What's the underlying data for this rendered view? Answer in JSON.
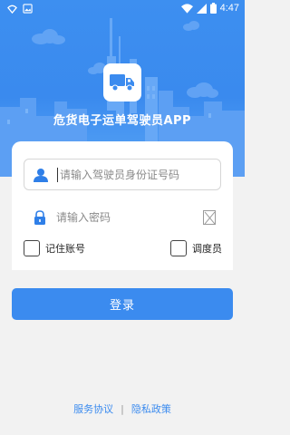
{
  "status_bar": {
    "time": "4:47",
    "left_icons": [
      "wifi-icon",
      "image-icon"
    ],
    "right_icons": [
      "wifi-signal-icon",
      "cellular-signal-icon",
      "battery-icon"
    ]
  },
  "app": {
    "title": "危货电子运单驾驶员APP",
    "logo_icon": "truck-icon"
  },
  "form": {
    "id_field": {
      "placeholder": "请输入驾驶员身份证号码",
      "value": "",
      "icon": "user-icon"
    },
    "password_field": {
      "placeholder": "请输入密码",
      "value": "",
      "icon": "lock-icon",
      "toggle_icon": "visibility-toggle-icon"
    },
    "remember_label": "记住账号",
    "remember_checked": false,
    "dispatcher_label": "调度员",
    "dispatcher_checked": false,
    "login_label": "登录"
  },
  "footer": {
    "service_agreement": "服务协议",
    "separator": "|",
    "privacy_policy": "隐私政策"
  },
  "colors": {
    "primary": "#3b8bef",
    "hero_top": "#3d8ff0",
    "background": "#f2f2f2",
    "user_icon": "#2f7fe8",
    "lock_icon": "#2f7fe8"
  }
}
